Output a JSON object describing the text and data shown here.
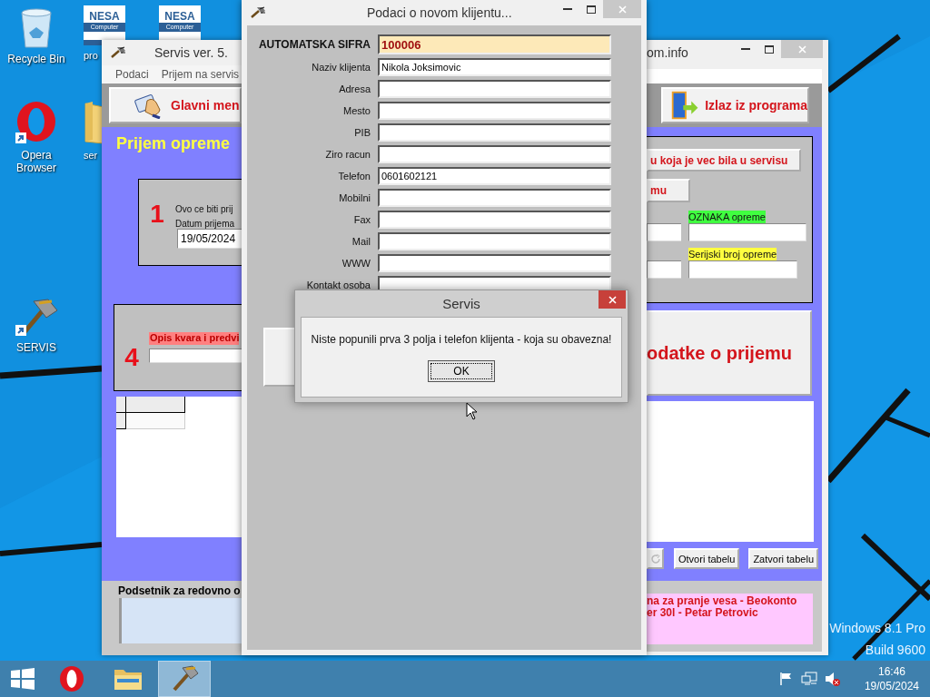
{
  "desktop": {
    "icons": [
      {
        "kind": "recycle-bin",
        "label": "Recycle Bin"
      },
      {
        "kind": "nesa",
        "logo": "NESA",
        "logo_subtitle": "Computer",
        "label": "pro"
      },
      {
        "kind": "nesa",
        "logo": "NESA",
        "logo_subtitle": "Computer"
      },
      {
        "kind": "opera",
        "label": "Opera Browser"
      },
      {
        "kind": "folder",
        "label": "ser"
      },
      {
        "kind": "hammer",
        "label": "SERVIS"
      }
    ],
    "watermark": [
      "Windows 8.1 Pro",
      "Build 9600"
    ]
  },
  "main_window": {
    "title_left": "Servis ver. 5.",
    "title_right": "om.info",
    "menu": [
      "Podaci",
      "Prijem na servis"
    ],
    "main_menu_button": "Glavni men",
    "exit_button": "Izlaz iz programa",
    "heading": "Prijem opreme",
    "panel_1": {
      "number": "1",
      "text": "Ovo ce biti prij",
      "date_label": "Datum prijema",
      "date_value": "19/05/2024"
    },
    "panel_right": {
      "history_button": "u koja je vec bila u servisu",
      "button_2": "mu",
      "tag_label": "OZNAKA opreme",
      "serial_label": "Serijski broj opreme"
    },
    "panel_4": {
      "number": "4",
      "label": "Opis kvara i predvi"
    },
    "save_button": "odatke o prijemu",
    "table_buttons": [
      "Otvori tabelu",
      "Zatvori tabelu"
    ],
    "reminder": {
      "title": "Podsetnik za redovno o",
      "lines": [
        "na za pranje vesa - Beokonto",
        "er 30l - Petar Petrovic"
      ]
    }
  },
  "client_window": {
    "title": "Podaci o novom klijentu...",
    "fields": [
      {
        "kind": "auto",
        "label": "AUTOMATSKA SIFRA",
        "value": "100006"
      },
      {
        "kind": "text",
        "label": "Naziv klijenta",
        "value": "Nikola Joksimovic"
      },
      {
        "kind": "text",
        "label": "Adresa"
      },
      {
        "kind": "text",
        "label": "Mesto"
      },
      {
        "kind": "text",
        "label": "PIB"
      },
      {
        "kind": "text",
        "label": "Ziro racun"
      },
      {
        "kind": "text",
        "label": "Telefon",
        "value": "0601602121"
      },
      {
        "kind": "text",
        "label": "Mobilni"
      },
      {
        "kind": "text",
        "label": "Fax"
      },
      {
        "kind": "text",
        "label": "Mail"
      },
      {
        "kind": "text",
        "label": "WWW"
      },
      {
        "kind": "text",
        "label": "Kontakt osoba"
      }
    ]
  },
  "dialog": {
    "title": "Servis",
    "message": "Niste popunili prva 3 polja i telefon klijenta - koja su obavezna!",
    "button": "OK"
  },
  "taskbar": {
    "apps": [
      {
        "kind": "opera",
        "selected": false
      },
      {
        "kind": "explorer",
        "selected": false
      },
      {
        "kind": "servis",
        "selected": true
      }
    ],
    "time": "16:46",
    "date": "19/05/2024"
  }
}
